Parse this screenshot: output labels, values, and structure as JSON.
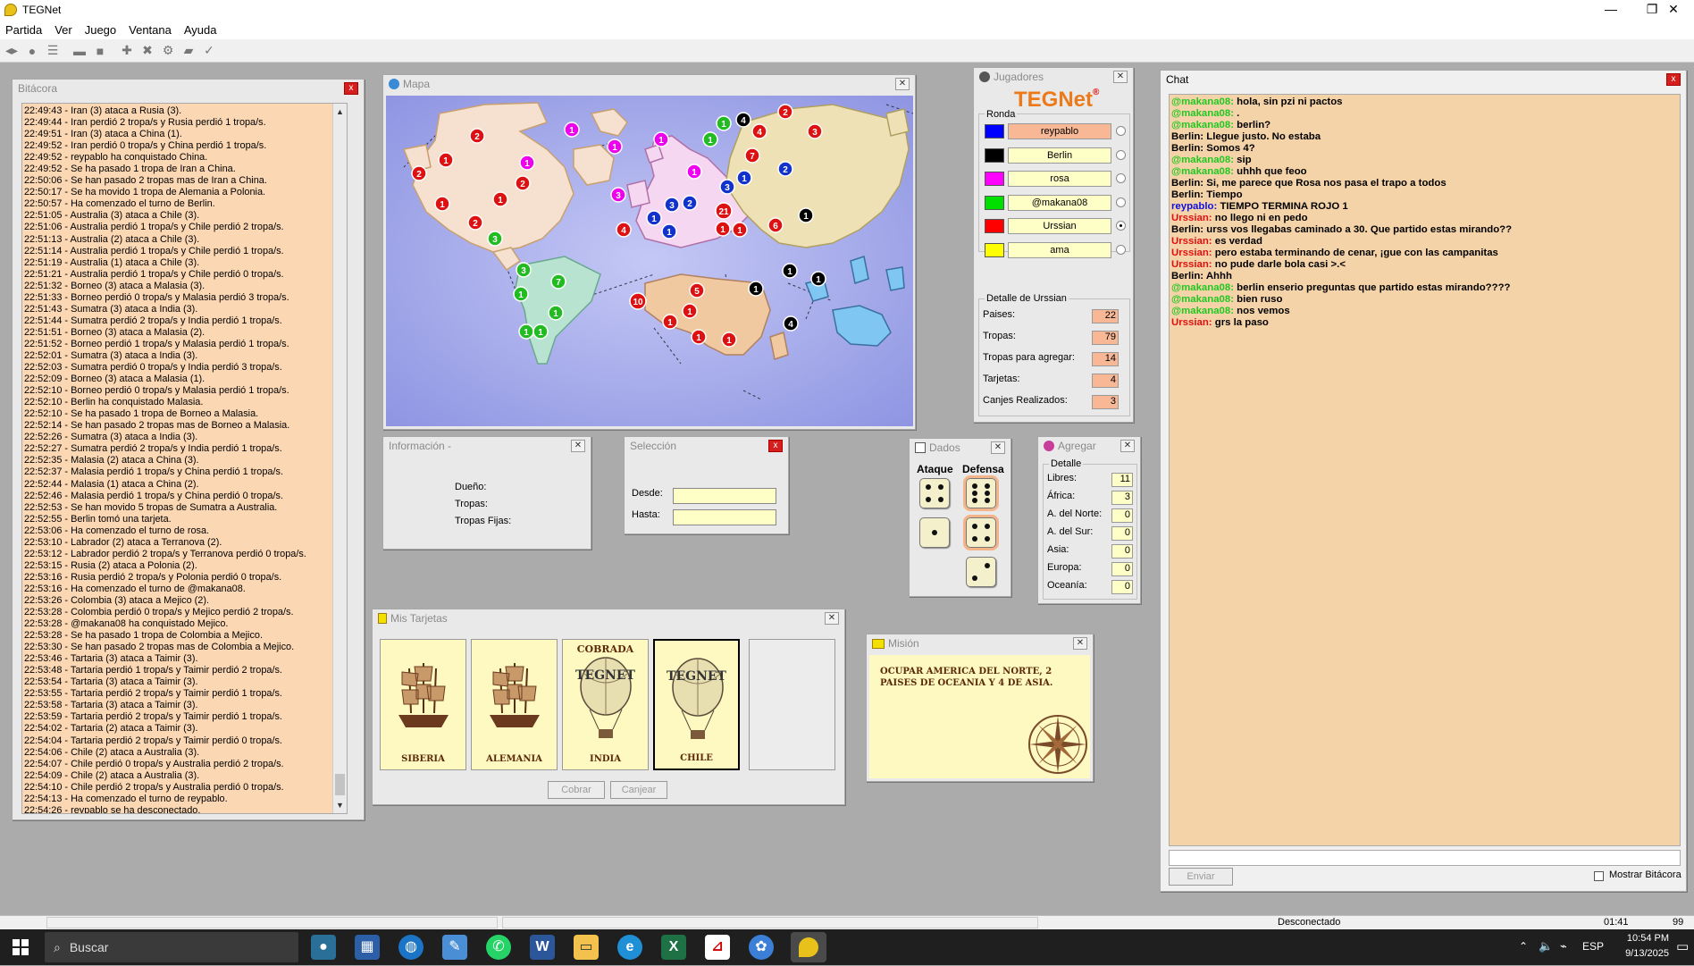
{
  "window": {
    "title": "TEGNet",
    "controls": [
      "—",
      "❐",
      "✕"
    ]
  },
  "menu": [
    "Partida",
    "Ver",
    "Juego",
    "Ventana",
    "Ayuda"
  ],
  "bitacora": {
    "title": "Bitácora",
    "lines": [
      "22:49:43 - Iran (3) ataca a Rusia (3).",
      "22:49:44 - Iran perdió 2 tropa/s y Rusia perdió 1 tropa/s.",
      "22:49:51 - Iran (3) ataca a China (1).",
      "22:49:52 - Iran perdió 0 tropa/s y China perdió 1 tropa/s.",
      "22:49:52 - reypablo ha conquistado China.",
      "22:49:52 - Se ha pasado 1 tropa de Iran a China.",
      "22:50:06 - Se han pasado 2 tropas mas de Iran a China.",
      "22:50:17 - Se ha movido 1 tropa de Alemania a Polonia.",
      "22:50:57 - Ha comenzado el turno de Berlin.",
      "22:51:05 - Australia (3) ataca a Chile (3).",
      "22:51:06 - Australia perdió 1 tropa/s y Chile perdió 2 tropa/s.",
      "22:51:13 - Australia (2) ataca a Chile (3).",
      "22:51:14 - Australia perdió 1 tropa/s y Chile perdió 1 tropa/s.",
      "22:51:19 - Australia (1) ataca a Chile (3).",
      "22:51:21 - Australia perdió 1 tropa/s y Chile perdió 0 tropa/s.",
      "22:51:32 - Borneo (3) ataca a Malasia (3).",
      "22:51:33 - Borneo perdió 0 tropa/s y Malasia perdió 3 tropa/s.",
      "22:51:43 - Sumatra (3) ataca a India (3).",
      "22:51:44 - Sumatra perdió 2 tropa/s y India perdió 1 tropa/s.",
      "22:51:51 - Borneo (3) ataca a Malasia (2).",
      "22:51:52 - Borneo perdió 1 tropa/s y Malasia perdió 1 tropa/s.",
      "22:52:01 - Sumatra (3) ataca a India (3).",
      "22:52:03 - Sumatra perdió 0 tropa/s y India perdió 3 tropa/s.",
      "22:52:09 - Borneo (3) ataca a Malasia (1).",
      "22:52:10 - Borneo perdió 0 tropa/s y Malasia perdió 1 tropa/s.",
      "22:52:10 - Berlin ha conquistado Malasia.",
      "22:52:10 - Se ha pasado 1 tropa de Borneo a Malasia.",
      "22:52:14 - Se han pasado 2 tropas mas de Borneo a Malasia.",
      "22:52:26 - Sumatra (3) ataca a India (3).",
      "22:52:27 - Sumatra perdió 2 tropa/s y India perdió 1 tropa/s.",
      "22:52:35 - Malasia (2) ataca a China (3).",
      "22:52:37 - Malasia perdió 1 tropa/s y China perdió 1 tropa/s.",
      "22:52:44 - Malasia (1) ataca a China (2).",
      "22:52:46 - Malasia perdió 1 tropa/s y China perdió 0 tropa/s.",
      "22:52:53 - Se han movido 5 tropas de Sumatra a Australia.",
      "22:52:55 - Berlin tomó una tarjeta.",
      "22:53:06 - Ha comenzado el turno de rosa.",
      "22:53:10 - Labrador (2) ataca a Terranova (2).",
      "22:53:12 - Labrador perdió 2 tropa/s y Terranova perdió 0 tropa/s.",
      "22:53:15 - Rusia (2) ataca a Polonia (2).",
      "22:53:16 - Rusia perdió 2 tropa/s y Polonia perdió 0 tropa/s.",
      "22:53:16 - Ha comenzado el turno de @makana08.",
      "22:53:26 - Colombia (3) ataca a Mejico (2).",
      "22:53:28 - Colombia perdió 0 tropa/s y Mejico perdió 2 tropa/s.",
      "22:53:28 - @makana08 ha conquistado Mejico.",
      "22:53:28 - Se ha pasado 1 tropa de Colombia a Mejico.",
      "22:53:30 - Se han pasado 2 tropas mas de Colombia a Mejico.",
      "22:53:46 - Tartaria (3) ataca a Taimir (3).",
      "22:53:48 - Tartaria perdió 1 tropa/s y Taimir perdió 2 tropa/s.",
      "22:53:54 - Tartaria (3) ataca a Taimir (3).",
      "22:53:55 - Tartaria perdió 2 tropa/s y Taimir perdió 1 tropa/s.",
      "22:53:58 - Tartaria (3) ataca a Taimir (3).",
      "22:53:59 - Tartaria perdió 2 tropa/s y Taimir perdió 1 tropa/s.",
      "22:54:02 - Tartaria (2) ataca a Taimir (3).",
      "22:54:04 - Tartaria perdió 2 tropa/s y Taimir perdió 0 tropa/s.",
      "22:54:06 - Chile (2) ataca a Australia (3).",
      "22:54:07 - Chile perdió 0 tropa/s y Australia perdió 2 tropa/s.",
      "22:54:09 - Chile (2) ataca a Australia (3).",
      "22:54:10 - Chile perdió 2 tropa/s y Australia perdió 0 tropa/s.",
      "22:54:13 - Ha comenzado el turno de reypablo.",
      "22:54:26 - reypablo se ha desconectado."
    ]
  },
  "mapa": {
    "title": "Mapa",
    "armies": [
      {
        "color": "#d11",
        "n": "2"
      },
      {
        "color": "#d11",
        "n": "1"
      },
      {
        "color": "#d11",
        "n": "2"
      },
      {
        "color": "#d11",
        "n": "1"
      },
      {
        "color": "#d11",
        "n": "1"
      },
      {
        "color": "#d11",
        "n": "2"
      },
      {
        "color": "#d11",
        "n": "2"
      },
      {
        "color": "#e0e",
        "n": "1"
      },
      {
        "color": "#e0e",
        "n": "1"
      },
      {
        "color": "#2b2",
        "n": "3"
      },
      {
        "color": "#2b2",
        "n": "3"
      },
      {
        "color": "#2b2",
        "n": "7"
      },
      {
        "color": "#2b2",
        "n": "1"
      },
      {
        "color": "#2b2",
        "n": "1"
      },
      {
        "color": "#2b2",
        "n": "1"
      },
      {
        "color": "#2b2",
        "n": "1"
      },
      {
        "color": "#e0e",
        "n": "1"
      },
      {
        "color": "#e0e",
        "n": "1"
      },
      {
        "color": "#e0e",
        "n": "3"
      },
      {
        "color": "#e0e",
        "n": "1"
      },
      {
        "color": "#d11",
        "n": "4"
      },
      {
        "color": "#13c",
        "n": "1"
      },
      {
        "color": "#13c",
        "n": "3"
      },
      {
        "color": "#13c",
        "n": "2"
      },
      {
        "color": "#13c",
        "n": "1"
      },
      {
        "color": "#d11",
        "n": "21"
      },
      {
        "color": "#d11",
        "n": "1"
      },
      {
        "color": "#d11",
        "n": "1"
      },
      {
        "color": "#2b2",
        "n": "1"
      },
      {
        "color": "#000",
        "n": "4"
      },
      {
        "color": "#2b2",
        "n": "1"
      },
      {
        "color": "#d11",
        "n": "2"
      },
      {
        "color": "#d11",
        "n": "4"
      },
      {
        "color": "#d11",
        "n": "3"
      },
      {
        "color": "#d11",
        "n": "7"
      },
      {
        "color": "#13c",
        "n": "1"
      },
      {
        "color": "#13c",
        "n": "3"
      },
      {
        "color": "#13c",
        "n": "2"
      },
      {
        "color": "#000",
        "n": "1"
      },
      {
        "color": "#d11",
        "n": "6"
      },
      {
        "color": "#d11",
        "n": "10"
      },
      {
        "color": "#d11",
        "n": "5"
      },
      {
        "color": "#d11",
        "n": "1"
      },
      {
        "color": "#d11",
        "n": "1"
      },
      {
        "color": "#d11",
        "n": "1"
      },
      {
        "color": "#d11",
        "n": "1"
      },
      {
        "color": "#000",
        "n": "1"
      },
      {
        "color": "#000",
        "n": "1"
      },
      {
        "color": "#000",
        "n": "1"
      },
      {
        "color": "#000",
        "n": "4"
      }
    ]
  },
  "info": {
    "title": "Información -",
    "dueno": "Dueño:",
    "tropas": "Tropas:",
    "fijas": "Tropas Fijas:"
  },
  "seleccion": {
    "title": "Selección",
    "desde": "Desde:",
    "hasta": "Hasta:"
  },
  "tarjetas": {
    "title": "Mis Tarjetas",
    "cards": [
      {
        "name": "SIBERIA",
        "top": "",
        "kind": "ship"
      },
      {
        "name": "ALEMANIA",
        "top": "",
        "kind": "ship"
      },
      {
        "name": "INDIA",
        "top": "COBRADA",
        "kind": "balloon"
      },
      {
        "name": "CHILE",
        "top": "",
        "kind": "balloon"
      }
    ],
    "cobrar": "Cobrar",
    "canjear": "Canjear",
    "logo_text": "TEGNET"
  },
  "dados": {
    "title": "Dados",
    "ataque": "Ataque",
    "defensa": "Defensa"
  },
  "jugadores": {
    "title": "Jugadores",
    "logo": "TEGNet",
    "ronda": "Ronda",
    "players": [
      {
        "name": "reypablo",
        "color": "#0000ff",
        "turn": true,
        "selected": false
      },
      {
        "name": "Berlin",
        "color": "#000000",
        "turn": false,
        "selected": false
      },
      {
        "name": "rosa",
        "color": "#ff00ff",
        "turn": false,
        "selected": false
      },
      {
        "name": "@makana08",
        "color": "#00e000",
        "turn": false,
        "selected": false
      },
      {
        "name": "Urssian",
        "color": "#ff0000",
        "turn": false,
        "selected": true
      },
      {
        "name": "ama",
        "color": "#ffff00",
        "turn": false,
        "selected": false
      }
    ],
    "detalle_title": "Detalle de Urssian",
    "stats": [
      {
        "label": "Paises:",
        "value": "22"
      },
      {
        "label": "Tropas:",
        "value": "79"
      },
      {
        "label": "Tropas para agregar:",
        "value": "14"
      },
      {
        "label": "Tarjetas:",
        "value": "4"
      },
      {
        "label": "Canjes Realizados:",
        "value": "3"
      }
    ]
  },
  "agregar": {
    "title": "Agregar",
    "detalle": "Detalle",
    "rows": [
      {
        "label": "Libres:",
        "value": "11"
      },
      {
        "label": "África:",
        "value": "3"
      },
      {
        "label": "A. del Norte:",
        "value": "0"
      },
      {
        "label": "A. del Sur:",
        "value": "0"
      },
      {
        "label": "Asia:",
        "value": "0"
      },
      {
        "label": "Europa:",
        "value": "0"
      },
      {
        "label": "Oceanía:",
        "value": "0"
      }
    ]
  },
  "mision": {
    "title": "Misión",
    "text": "OCUPAR AMERICA DEL NORTE, 2 PAISES DE OCEANIA Y 4 DE ASIA."
  },
  "chat": {
    "title": "Chat",
    "lines": [
      {
        "who": "@makana08:",
        "color": "#21c821",
        "text": "hola, sin pzi ni pactos"
      },
      {
        "who": "@makana08:",
        "color": "#21c821",
        "text": "."
      },
      {
        "who": "@makana08:",
        "color": "#21c821",
        "text": "berlin?"
      },
      {
        "who": "Berlin:",
        "color": "#000000",
        "text": "Llegue justo. No estaba"
      },
      {
        "who": "Berlin:",
        "color": "#000000",
        "text": "Somos 4?"
      },
      {
        "who": "@makana08:",
        "color": "#21c821",
        "text": "sip"
      },
      {
        "who": "@makana08:",
        "color": "#21c821",
        "text": "uhhh que feoo"
      },
      {
        "who": "Berlin:",
        "color": "#000000",
        "text": "Si, me parece que Rosa nos pasa el trapo a todos"
      },
      {
        "who": "Berlin:",
        "color": "#000000",
        "text": "Tiempo"
      },
      {
        "who": "reypablo:",
        "color": "#1010e0",
        "text": "TIEMPO TERMINA ROJO 1"
      },
      {
        "who": "Urssian:",
        "color": "#e01010",
        "text": "no llego ni en pedo"
      },
      {
        "who": "Berlin:",
        "color": "#000000",
        "text": "urss vos llegabas caminado a 30. Que partido estas mirando??"
      },
      {
        "who": "Urssian:",
        "color": "#e01010",
        "text": "es verdad"
      },
      {
        "who": "Urssian:",
        "color": "#e01010",
        "text": "pero estaba terminando de cenar, ¡gue con las campanitas"
      },
      {
        "who": "Urssian:",
        "color": "#e01010",
        "text": "no pude darle bola casi >.<"
      },
      {
        "who": "Berlin:",
        "color": "#000000",
        "text": "Ahhh"
      },
      {
        "who": "@makana08:",
        "color": "#21c821",
        "text": "berlin enserio preguntas que partido estas mirando????"
      },
      {
        "who": "@makana08:",
        "color": "#21c821",
        "text": "bien ruso"
      },
      {
        "who": "@makana08:",
        "color": "#21c821",
        "text": "nos vemos"
      },
      {
        "who": "Urssian:",
        "color": "#e01010",
        "text": "grs la paso"
      }
    ],
    "send": "Enviar",
    "mostrar": "Mostrar Bitácora"
  },
  "status": {
    "conn": "Desconectado",
    "time": "01:41",
    "num": "99"
  },
  "taskbar": {
    "search": "Buscar",
    "clock_time": "10:54 PM",
    "clock_date": "9/13/2025",
    "lang": "ESP"
  }
}
